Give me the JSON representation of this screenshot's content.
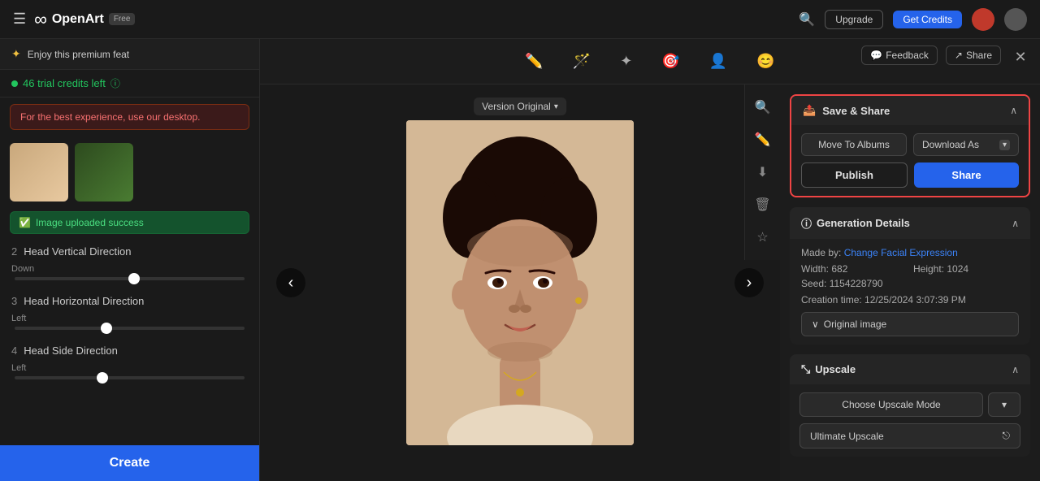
{
  "app": {
    "logo_text": "OpenArt",
    "logo_badge": "Free"
  },
  "nav": {
    "upgrade_label": "Upgrade",
    "get_credits_label": "Get Credits",
    "feedback_label": "Feedback",
    "share_label": "Share"
  },
  "sidebar": {
    "premium_text": "Enjoy this premium feat",
    "credits_text": "46 trial credits left",
    "warning_text": "For the best experience, use our desktop.",
    "success_text": "Image uploaded success",
    "section2_label": "Head Vertical Direction",
    "section2_num": "2",
    "slider2_label": "Down",
    "slider2_pos": "52%",
    "section3_label": "Head Horizontal Direction",
    "section3_num": "3",
    "slider3_label": "Left",
    "slider3_pos": "40%",
    "section4_label": "Head Side Direction",
    "section4_num": "4",
    "slider4_label": "Left",
    "slider4_pos": "38%",
    "create_label": "Create"
  },
  "toolbar": {
    "icons": [
      "✏️",
      "🪄",
      "✦",
      "🎯",
      "👤",
      "😊"
    ]
  },
  "version_badge": {
    "label": "Version Original",
    "chevron": "▾"
  },
  "save_share": {
    "title": "Save & Share",
    "move_albums_label": "Move To Albums",
    "download_as_label": "Download As",
    "publish_label": "Publish",
    "share_label": "Share"
  },
  "generation_details": {
    "title": "Generation Details",
    "made_by_label": "Made by:",
    "made_by_value": "Change Facial Expression",
    "width_label": "Width:",
    "width_value": "682",
    "height_label": "Height:",
    "height_value": "1024",
    "seed_label": "Seed:",
    "seed_value": "1154228790",
    "creation_label": "Creation time:",
    "creation_value": "12/25/2024 3:07:39 PM",
    "original_image_label": "Original image"
  },
  "upscale": {
    "title": "Upscale",
    "choose_label": "Choose Upscale Mode",
    "ultimate_label": "Ultimate Upscale"
  },
  "colors": {
    "highlight_border": "#ef4444",
    "accent_blue": "#2563eb",
    "success_green": "#22c55e"
  }
}
